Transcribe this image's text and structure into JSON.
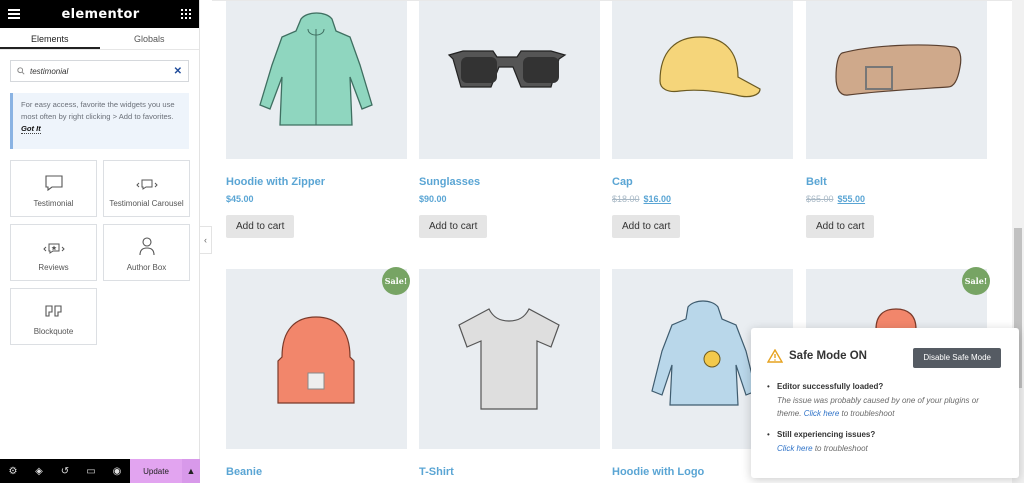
{
  "sidebar": {
    "logo": "elementor",
    "tabs": [
      {
        "label": "Elements"
      },
      {
        "label": "Globals"
      }
    ],
    "search": {
      "value": "testimonial"
    },
    "tip": {
      "text": "For easy access, favorite the widgets you use most often by right clicking > Add to favorites.",
      "link": "Got It"
    },
    "widgets": [
      {
        "label": "Testimonial",
        "icon": "testimonial-icon"
      },
      {
        "label": "Testimonial Carousel",
        "icon": "testimonial-carousel-icon"
      },
      {
        "label": "Reviews",
        "icon": "reviews-icon"
      },
      {
        "label": "Author Box",
        "icon": "author-box-icon"
      },
      {
        "label": "Blockquote",
        "icon": "blockquote-icon"
      }
    ],
    "bottombar": {
      "icons": [
        "settings-icon",
        "layers-icon",
        "history-icon",
        "responsive-icon",
        "preview-icon"
      ],
      "update_label": "Update"
    }
  },
  "products": [
    {
      "name": "Hoodie with Zipper",
      "price": "$45.00",
      "old_price": "",
      "button": "Add to cart",
      "image": "hoodie-zipper"
    },
    {
      "name": "Sunglasses",
      "price": "$90.00",
      "old_price": "",
      "button": "Add to cart",
      "image": "sunglasses"
    },
    {
      "name": "Cap",
      "price": "$16.00",
      "old_price": "$18.00",
      "button": "Add to cart",
      "image": "cap"
    },
    {
      "name": "Belt",
      "price": "$55.00",
      "old_price": "$65.00",
      "button": "Add to cart",
      "image": "belt"
    },
    {
      "name": "Beanie",
      "sale": "Sale!",
      "image": "beanie"
    },
    {
      "name": "T-Shirt",
      "image": "tshirt"
    },
    {
      "name": "Hoodie with Logo",
      "image": "hoodie-logo"
    },
    {
      "name": "",
      "sale": "Sale!",
      "image": "beanie-partial"
    }
  ],
  "safe_mode": {
    "title": "Safe Mode ON",
    "button": "Disable Safe Mode",
    "items": [
      {
        "head": "Editor successfully loaded?",
        "desc": "The issue was probably caused by one of your plugins or theme.",
        "link": "Click here",
        "tail": "to troubleshoot"
      },
      {
        "head": "Still experiencing issues?",
        "desc": "",
        "link": "Click here",
        "tail": "to troubleshoot"
      }
    ]
  },
  "colors": {
    "accent_link": "#5aa5d4",
    "sale_badge": "#77a464",
    "update_button": "#e2a4f0"
  }
}
